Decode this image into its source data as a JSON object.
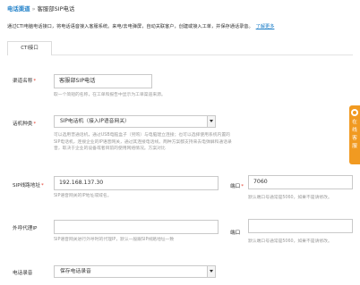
{
  "breadcrumb": {
    "parent": "电话渠道",
    "separator": "»",
    "current": "客服部SIP电话"
  },
  "intro": {
    "text": "通过CTI电脑电话接口，将电话语音接入客服系统。来电/去电弹屏，自动关联客户，创建或接入工单，并保存通话录音。",
    "link": "了解更多"
  },
  "tabs": [
    {
      "label": "CTI接口"
    }
  ],
  "form": {
    "channel_name": {
      "label": "渠道名称",
      "required": "*",
      "value": "客服部SIP电话",
      "hint": "取一个简短的名称，在工单和报告中显示为工单渠道来源。"
    },
    "device_type": {
      "label": "话机种类",
      "required": "*",
      "value": "SIP电话机（接入IP语音网关）",
      "hint_lines": [
        "可以选用普通话机，通过USB电脑盒子（另购）与电脑建立连接；也可以选择使用系统内置的",
        "SIP电话机，连接企业的IP语音网关，通过其连接电话线。两种方案都支持来去电弹屏和通话录",
        "音，取决于企业的设备或者目前的使用网络情况。方案对比"
      ]
    },
    "sip_address": {
      "label": "SIP线路地址",
      "required": "*",
      "value": "192.168.137.30",
      "hint": "SIP语音网关的IP地址或域名。"
    },
    "sip_port": {
      "label": "端口",
      "required": "*",
      "value": "7060",
      "hint": "默认端口号通常是5060，如果不是请修改。"
    },
    "proxy": {
      "label": "外呼代理IP",
      "value": "",
      "hint": "SIP语音网关进行外呼时的代理IP，默认一般跟SIP线路地址一致"
    },
    "proxy_port": {
      "label": "端口",
      "value": "",
      "hint": "默认端口号通常是5060，如果不是请修改。"
    },
    "recording": {
      "label": "电话录音",
      "value": "保存电话录音"
    }
  },
  "side_widget": {
    "chars": [
      "在",
      "线",
      "客",
      "服"
    ],
    "color": "#f19a21"
  },
  "colors": {
    "link": "#1e7fc8",
    "required": "#e23b2b",
    "hint": "#9a9a9a"
  }
}
